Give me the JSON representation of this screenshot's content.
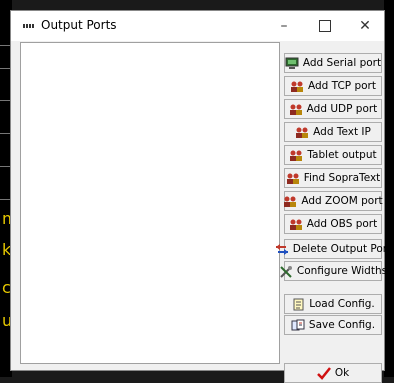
{
  "window": {
    "title": "Output Ports"
  },
  "controls": {
    "minimize": "–",
    "close": "✕"
  },
  "background_letters": [
    "m",
    "k",
    "c",
    "u"
  ],
  "buttons": [
    {
      "label": "Add Serial port",
      "icon": "monitor-icon"
    },
    {
      "label": "Add TCP port",
      "icon": "network-users-icon"
    },
    {
      "label": "Add UDP port",
      "icon": "network-users-icon"
    },
    {
      "label": "Add Text IP",
      "icon": "network-users-icon"
    },
    {
      "label": "Tablet output",
      "icon": "network-users-icon"
    },
    {
      "label": "Find SopraText",
      "icon": "network-users-icon"
    },
    {
      "label": "Add ZOOM port",
      "icon": "network-users-icon"
    },
    {
      "label": "Add OBS port",
      "icon": "network-users-icon"
    },
    {
      "label": "Delete Output Port",
      "icon": "delete-arrows-icon"
    },
    {
      "label": "Configure Widths",
      "icon": "tools-icon"
    },
    {
      "label": "Load Config.",
      "icon": "document-icon"
    },
    {
      "label": "Save Config.",
      "icon": "save-documents-icon"
    },
    {
      "label": "Ok",
      "icon": "checkmark-icon"
    }
  ]
}
